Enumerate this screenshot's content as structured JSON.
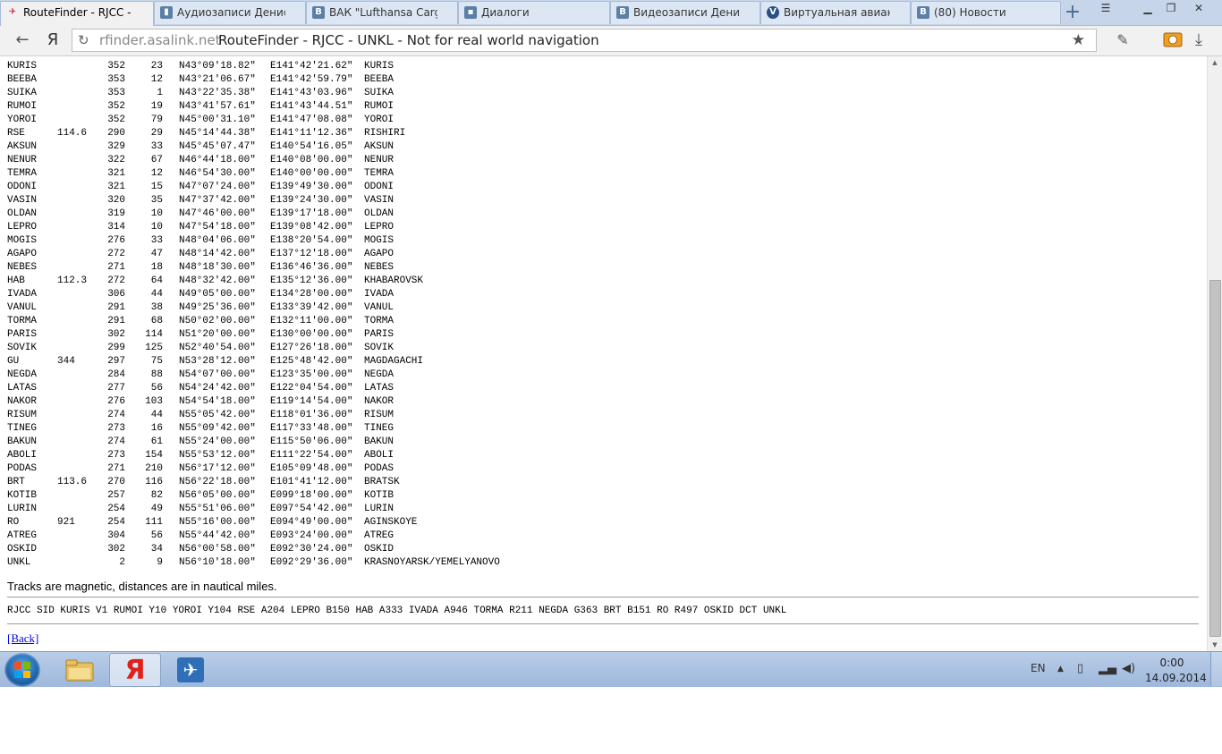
{
  "browser": {
    "tabs": [
      {
        "label": "RouteFinder - RJCC - U",
        "icon": "airplane-favicon",
        "active": true
      },
      {
        "label": "Аудиозаписи Дениса",
        "icon": "vk-favicon",
        "active": false
      },
      {
        "label": "ВАК \"Lufthansa Cargo",
        "icon": "vk-favicon",
        "active": false
      },
      {
        "label": "Диалоги",
        "icon": "vk-dialogs-favicon",
        "active": false
      },
      {
        "label": "Видеозаписи Дениса",
        "icon": "vk-favicon",
        "active": false
      },
      {
        "label": "Виртуальная авиаком",
        "icon": "va-favicon",
        "active": false
      },
      {
        "label": "(80) Новости",
        "icon": "vk-favicon",
        "active": false
      }
    ],
    "new_tab_label": "+",
    "back_icon": "arrow-left-icon",
    "yandex_logo": "Я",
    "address": {
      "domain": "rfinder.asalink.net",
      "page_title": "RouteFinder - RJCC - UNKL - Not for real world navigation"
    },
    "window_controls": [
      "minimize-icon",
      "restore-icon",
      "close-icon"
    ]
  },
  "route": {
    "rows": [
      {
        "id": "KURIS",
        "freq": "",
        "trk": "352",
        "dist": "23",
        "lat": "N43°09'18.82\"",
        "lon": "E141°42'21.62\"",
        "name": "KURIS"
      },
      {
        "id": "BEEBA",
        "freq": "",
        "trk": "353",
        "dist": "12",
        "lat": "N43°21'06.67\"",
        "lon": "E141°42'59.79\"",
        "name": "BEEBA"
      },
      {
        "id": "SUIKA",
        "freq": "",
        "trk": "353",
        "dist": "1",
        "lat": "N43°22'35.38\"",
        "lon": "E141°43'03.96\"",
        "name": "SUIKA"
      },
      {
        "id": "RUMOI",
        "freq": "",
        "trk": "352",
        "dist": "19",
        "lat": "N43°41'57.61\"",
        "lon": "E141°43'44.51\"",
        "name": "RUMOI"
      },
      {
        "id": "YOROI",
        "freq": "",
        "trk": "352",
        "dist": "79",
        "lat": "N45°00'31.10\"",
        "lon": "E141°47'08.08\"",
        "name": "YOROI"
      },
      {
        "id": "RSE",
        "freq": "114.6",
        "trk": "290",
        "dist": "29",
        "lat": "N45°14'44.38\"",
        "lon": "E141°11'12.36\"",
        "name": "RISHIRI"
      },
      {
        "id": "AKSUN",
        "freq": "",
        "trk": "329",
        "dist": "33",
        "lat": "N45°45'07.47\"",
        "lon": "E140°54'16.05\"",
        "name": "AKSUN"
      },
      {
        "id": "NENUR",
        "freq": "",
        "trk": "322",
        "dist": "67",
        "lat": "N46°44'18.00\"",
        "lon": "E140°08'00.00\"",
        "name": "NENUR"
      },
      {
        "id": "TEMRA",
        "freq": "",
        "trk": "321",
        "dist": "12",
        "lat": "N46°54'30.00\"",
        "lon": "E140°00'00.00\"",
        "name": "TEMRA"
      },
      {
        "id": "ODONI",
        "freq": "",
        "trk": "321",
        "dist": "15",
        "lat": "N47°07'24.00\"",
        "lon": "E139°49'30.00\"",
        "name": "ODONI"
      },
      {
        "id": "VASIN",
        "freq": "",
        "trk": "320",
        "dist": "35",
        "lat": "N47°37'42.00\"",
        "lon": "E139°24'30.00\"",
        "name": "VASIN"
      },
      {
        "id": "OLDAN",
        "freq": "",
        "trk": "319",
        "dist": "10",
        "lat": "N47°46'00.00\"",
        "lon": "E139°17'18.00\"",
        "name": "OLDAN"
      },
      {
        "id": "LEPRO",
        "freq": "",
        "trk": "314",
        "dist": "10",
        "lat": "N47°54'18.00\"",
        "lon": "E139°08'42.00\"",
        "name": "LEPRO"
      },
      {
        "id": "MOGIS",
        "freq": "",
        "trk": "276",
        "dist": "33",
        "lat": "N48°04'06.00\"",
        "lon": "E138°20'54.00\"",
        "name": "MOGIS"
      },
      {
        "id": "AGAPO",
        "freq": "",
        "trk": "272",
        "dist": "47",
        "lat": "N48°14'42.00\"",
        "lon": "E137°12'18.00\"",
        "name": "AGAPO"
      },
      {
        "id": "NEBES",
        "freq": "",
        "trk": "271",
        "dist": "18",
        "lat": "N48°18'30.00\"",
        "lon": "E136°46'36.00\"",
        "name": "NEBES"
      },
      {
        "id": "HAB",
        "freq": "112.3",
        "trk": "272",
        "dist": "64",
        "lat": "N48°32'42.00\"",
        "lon": "E135°12'36.00\"",
        "name": "KHABAROVSK"
      },
      {
        "id": "IVADA",
        "freq": "",
        "trk": "306",
        "dist": "44",
        "lat": "N49°05'00.00\"",
        "lon": "E134°28'00.00\"",
        "name": "IVADA"
      },
      {
        "id": "VANUL",
        "freq": "",
        "trk": "291",
        "dist": "38",
        "lat": "N49°25'36.00\"",
        "lon": "E133°39'42.00\"",
        "name": "VANUL"
      },
      {
        "id": "TORMA",
        "freq": "",
        "trk": "291",
        "dist": "68",
        "lat": "N50°02'00.00\"",
        "lon": "E132°11'00.00\"",
        "name": "TORMA"
      },
      {
        "id": "PARIS",
        "freq": "",
        "trk": "302",
        "dist": "114",
        "lat": "N51°20'00.00\"",
        "lon": "E130°00'00.00\"",
        "name": "PARIS"
      },
      {
        "id": "SOVIK",
        "freq": "",
        "trk": "299",
        "dist": "125",
        "lat": "N52°40'54.00\"",
        "lon": "E127°26'18.00\"",
        "name": "SOVIK"
      },
      {
        "id": "GU",
        "freq": "344",
        "trk": "297",
        "dist": "75",
        "lat": "N53°28'12.00\"",
        "lon": "E125°48'42.00\"",
        "name": "MAGDAGACHI"
      },
      {
        "id": "NEGDA",
        "freq": "",
        "trk": "284",
        "dist": "88",
        "lat": "N54°07'00.00\"",
        "lon": "E123°35'00.00\"",
        "name": "NEGDA"
      },
      {
        "id": "LATAS",
        "freq": "",
        "trk": "277",
        "dist": "56",
        "lat": "N54°24'42.00\"",
        "lon": "E122°04'54.00\"",
        "name": "LATAS"
      },
      {
        "id": "NAKOR",
        "freq": "",
        "trk": "276",
        "dist": "103",
        "lat": "N54°54'18.00\"",
        "lon": "E119°14'54.00\"",
        "name": "NAKOR"
      },
      {
        "id": "RISUM",
        "freq": "",
        "trk": "274",
        "dist": "44",
        "lat": "N55°05'42.00\"",
        "lon": "E118°01'36.00\"",
        "name": "RISUM"
      },
      {
        "id": "TINEG",
        "freq": "",
        "trk": "273",
        "dist": "16",
        "lat": "N55°09'42.00\"",
        "lon": "E117°33'48.00\"",
        "name": "TINEG"
      },
      {
        "id": "BAKUN",
        "freq": "",
        "trk": "274",
        "dist": "61",
        "lat": "N55°24'00.00\"",
        "lon": "E115°50'06.00\"",
        "name": "BAKUN"
      },
      {
        "id": "ABOLI",
        "freq": "",
        "trk": "273",
        "dist": "154",
        "lat": "N55°53'12.00\"",
        "lon": "E111°22'54.00\"",
        "name": "ABOLI"
      },
      {
        "id": "PODAS",
        "freq": "",
        "trk": "271",
        "dist": "210",
        "lat": "N56°17'12.00\"",
        "lon": "E105°09'48.00\"",
        "name": "PODAS"
      },
      {
        "id": "BRT",
        "freq": "113.6",
        "trk": "270",
        "dist": "116",
        "lat": "N56°22'18.00\"",
        "lon": "E101°41'12.00\"",
        "name": "BRATSK"
      },
      {
        "id": "KOTIB",
        "freq": "",
        "trk": "257",
        "dist": "82",
        "lat": "N56°05'00.00\"",
        "lon": "E099°18'00.00\"",
        "name": "KOTIB"
      },
      {
        "id": "LURIN",
        "freq": "",
        "trk": "254",
        "dist": "49",
        "lat": "N55°51'06.00\"",
        "lon": "E097°54'42.00\"",
        "name": "LURIN"
      },
      {
        "id": "RO",
        "freq": "921",
        "trk": "254",
        "dist": "111",
        "lat": "N55°16'00.00\"",
        "lon": "E094°49'00.00\"",
        "name": "AGINSKOYE"
      },
      {
        "id": "ATREG",
        "freq": "",
        "trk": "304",
        "dist": "56",
        "lat": "N55°44'42.00\"",
        "lon": "E093°24'00.00\"",
        "name": "ATREG"
      },
      {
        "id": "OSKID",
        "freq": "",
        "trk": "302",
        "dist": "34",
        "lat": "N56°00'58.00\"",
        "lon": "E092°30'24.00\"",
        "name": "OSKID"
      },
      {
        "id": "UNKL",
        "freq": "",
        "trk": "2",
        "dist": "9",
        "lat": "N56°10'18.00\"",
        "lon": "E092°29'36.00\"",
        "name": "KRASNOYARSK/YEMELYANOVO"
      }
    ],
    "note": "Tracks are magnetic, distances are in nautical miles.",
    "route_string": "RJCC SID KURIS V1 RUMOI Y10 YOROI Y104 RSE A204 LEPRO B150 HAB A333 IVADA A946 TORMA R211 NEGDA G363 BRT B151 RO R497 OSKID DCT UNKL",
    "back_link": "[Back]"
  },
  "taskbar": {
    "apps": [
      {
        "name": "explorer-folder-icon"
      },
      {
        "name": "yandex-browser-icon",
        "active": true
      },
      {
        "name": "flight-sim-airplane-icon"
      }
    ],
    "lang": "EN",
    "time": "0:00",
    "date": "14.09.2014"
  }
}
